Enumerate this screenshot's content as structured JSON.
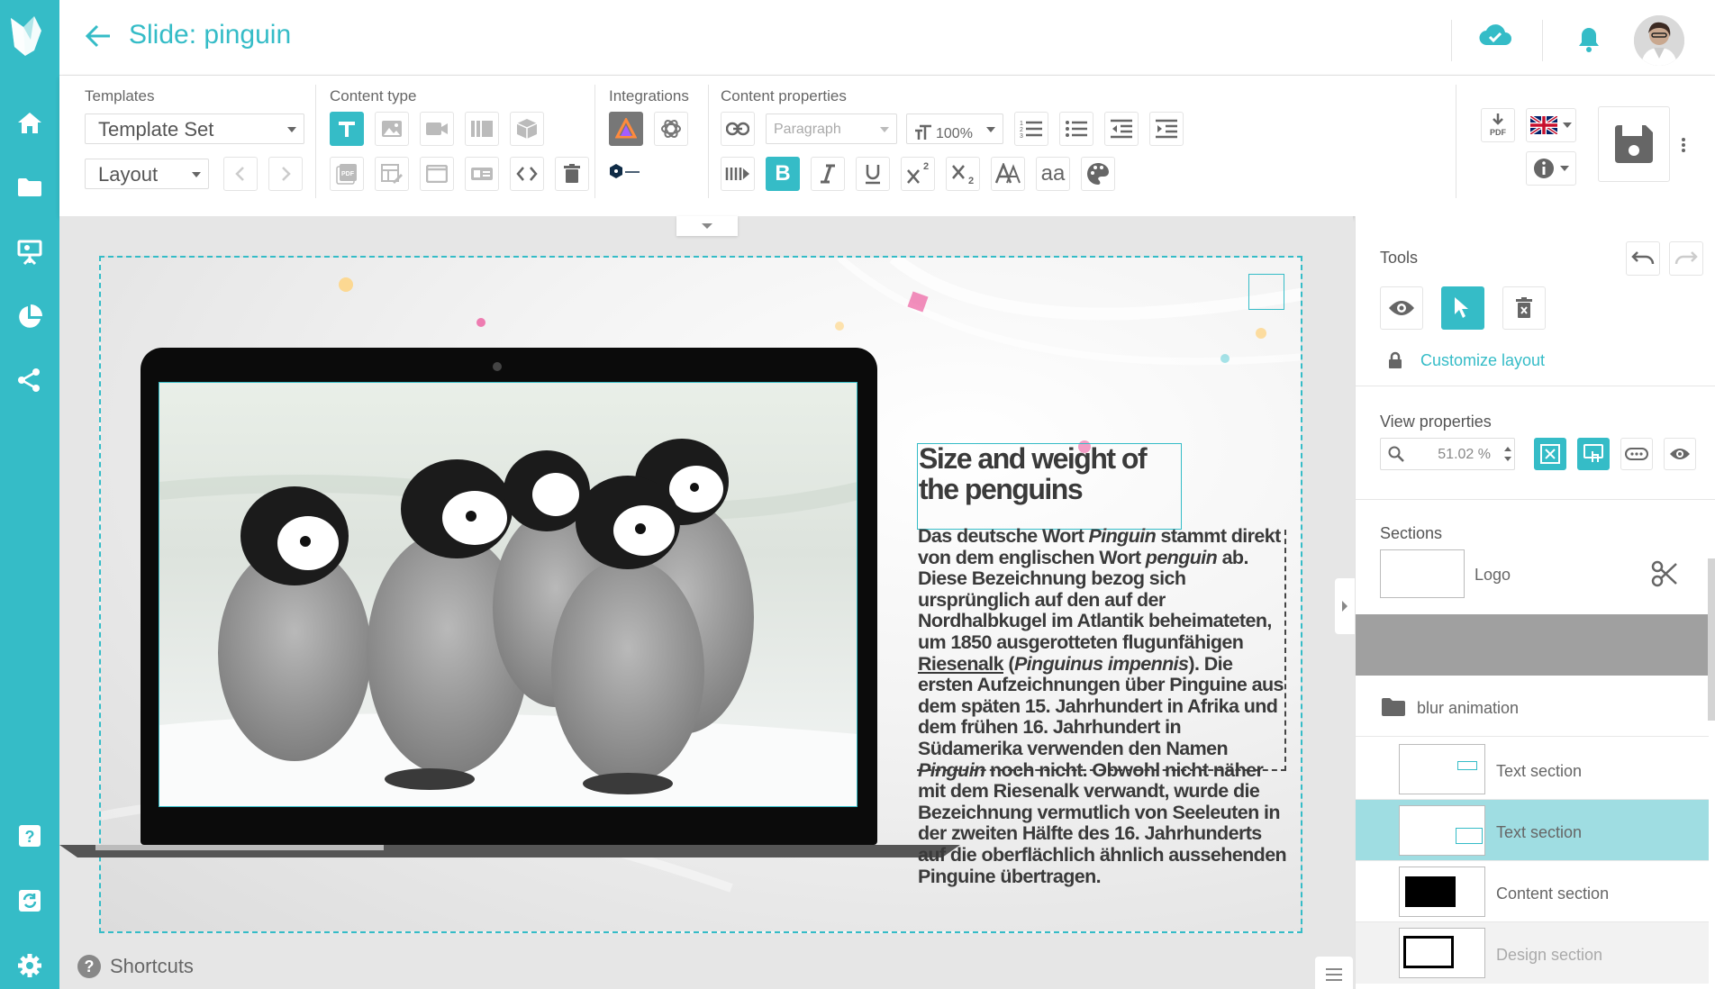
{
  "app": {
    "title": "Slide: pinguin",
    "accent": "#35bcc7"
  },
  "sidebar": {
    "items": [
      "home-icon",
      "folder-icon",
      "presentation-icon",
      "pie-chart-icon",
      "share-icon",
      "help-icon",
      "refresh-icon",
      "settings-icon"
    ]
  },
  "ribbon": {
    "templates": {
      "title": "Templates",
      "template_set": "Template Set",
      "layout": "Layout"
    },
    "content_type": {
      "title": "Content type"
    },
    "integrations": {
      "title": "Integrations"
    },
    "content_properties": {
      "title": "Content properties",
      "paragraph": "Paragraph",
      "zoom": "100%",
      "superscript": "2",
      "subscript": "2",
      "font_size_label": "aa"
    }
  },
  "slide": {
    "headline": "Size and weight of the penguins",
    "body": {
      "p1": "Das deutsche Wort ",
      "i1": "Pinguin",
      "p2": " stammt direkt von dem englischen Wort ",
      "i2": "penguin",
      "p3": " ab. Diese Bezeichnung bezog sich ursprünglich auf den auf der Nordhalbkugel im Atlantik beheimateten, um 1850 ausgerotteten flugunfähigen ",
      "link": "Riesenalk",
      "p4": " (",
      "i3": "Pinguinus impennis",
      "p5": "). Die ersten Aufzeichnungen über Pinguine aus dem späten 15. Jahrhundert in Afrika und dem frühen 16. Jahrhundert in Südamerika verwenden den Namen ",
      "i4": "Pinguin",
      "p6": " noch nicht. Obwohl nicht näher mit dem Riesenalk verwandt, wurde die Bezeichnung vermutlich von Seeleuten in der zweiten Hälfte des 16. Jahrhunderts auf die oberflächlich ähnlich aussehenden Pinguine übertragen."
    }
  },
  "footer": {
    "shortcuts": "Shortcuts"
  },
  "panel": {
    "tools": {
      "title": "Tools",
      "customize": "Customize layout"
    },
    "view": {
      "title": "View properties",
      "zoom": "51.02 %"
    },
    "sections": {
      "title": "Sections",
      "items": [
        {
          "label": "Logo"
        },
        {
          "label": ""
        },
        {
          "label": "blur animation"
        },
        {
          "label": "Text section"
        },
        {
          "label": "Text section"
        },
        {
          "label": "Content section"
        },
        {
          "label": "Design section"
        }
      ]
    }
  }
}
